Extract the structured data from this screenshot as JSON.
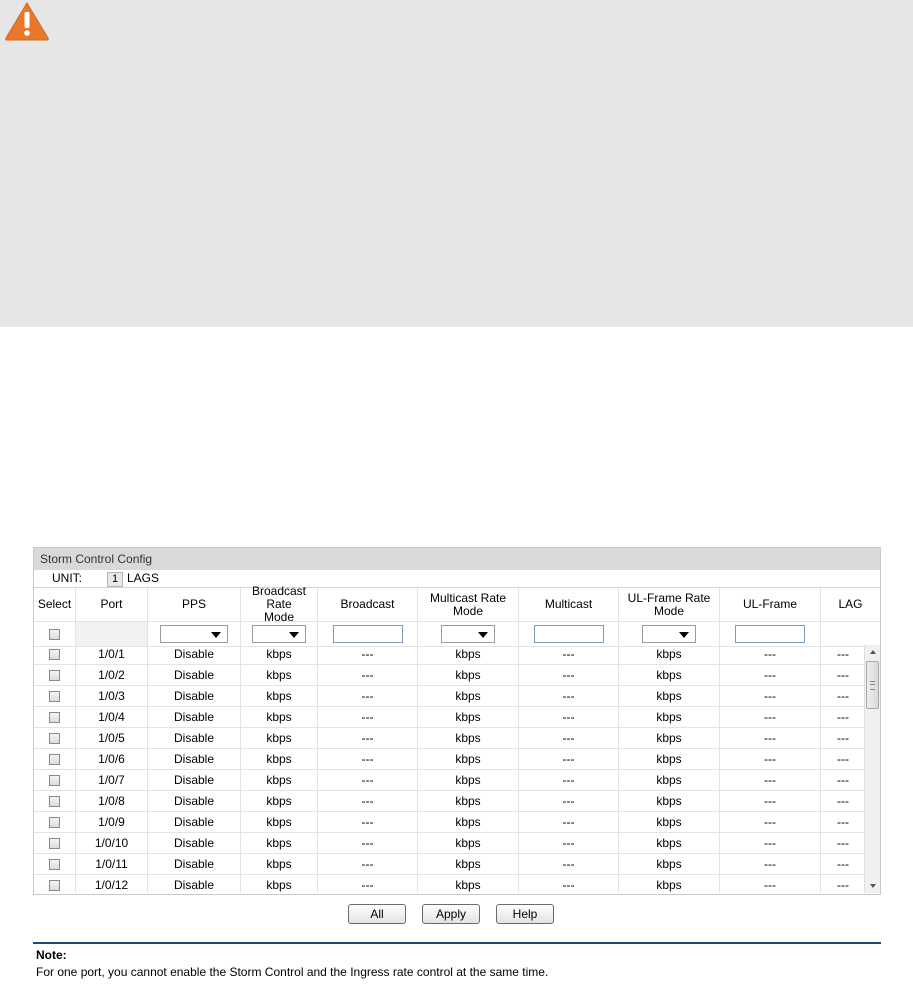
{
  "panel": {
    "title": "Storm Control Config",
    "unit_label": "UNIT:",
    "unit_value": "1",
    "lags_label": "LAGS"
  },
  "columns": {
    "select": "Select",
    "port": "Port",
    "pps": "PPS",
    "broadcast_rate_mode": "Broadcast Rate\nMode",
    "broadcast": "Broadcast",
    "multicast_rate_mode": "Multicast Rate\nMode",
    "multicast": "Multicast",
    "ulframe_rate_mode": "UL-Frame Rate\nMode",
    "ulframe": "UL-Frame",
    "lag": "LAG"
  },
  "rows": [
    {
      "port": "1/0/1",
      "pps": "Disable",
      "broadcast_rate_mode": "kbps",
      "broadcast": "---",
      "multicast_rate_mode": "kbps",
      "multicast": "---",
      "ulframe_rate_mode": "kbps",
      "ulframe": "---",
      "lag": "---"
    },
    {
      "port": "1/0/2",
      "pps": "Disable",
      "broadcast_rate_mode": "kbps",
      "broadcast": "---",
      "multicast_rate_mode": "kbps",
      "multicast": "---",
      "ulframe_rate_mode": "kbps",
      "ulframe": "---",
      "lag": "---"
    },
    {
      "port": "1/0/3",
      "pps": "Disable",
      "broadcast_rate_mode": "kbps",
      "broadcast": "---",
      "multicast_rate_mode": "kbps",
      "multicast": "---",
      "ulframe_rate_mode": "kbps",
      "ulframe": "---",
      "lag": "---"
    },
    {
      "port": "1/0/4",
      "pps": "Disable",
      "broadcast_rate_mode": "kbps",
      "broadcast": "---",
      "multicast_rate_mode": "kbps",
      "multicast": "---",
      "ulframe_rate_mode": "kbps",
      "ulframe": "---",
      "lag": "---"
    },
    {
      "port": "1/0/5",
      "pps": "Disable",
      "broadcast_rate_mode": "kbps",
      "broadcast": "---",
      "multicast_rate_mode": "kbps",
      "multicast": "---",
      "ulframe_rate_mode": "kbps",
      "ulframe": "---",
      "lag": "---"
    },
    {
      "port": "1/0/6",
      "pps": "Disable",
      "broadcast_rate_mode": "kbps",
      "broadcast": "---",
      "multicast_rate_mode": "kbps",
      "multicast": "---",
      "ulframe_rate_mode": "kbps",
      "ulframe": "---",
      "lag": "---"
    },
    {
      "port": "1/0/7",
      "pps": "Disable",
      "broadcast_rate_mode": "kbps",
      "broadcast": "---",
      "multicast_rate_mode": "kbps",
      "multicast": "---",
      "ulframe_rate_mode": "kbps",
      "ulframe": "---",
      "lag": "---"
    },
    {
      "port": "1/0/8",
      "pps": "Disable",
      "broadcast_rate_mode": "kbps",
      "broadcast": "---",
      "multicast_rate_mode": "kbps",
      "multicast": "---",
      "ulframe_rate_mode": "kbps",
      "ulframe": "---",
      "lag": "---"
    },
    {
      "port": "1/0/9",
      "pps": "Disable",
      "broadcast_rate_mode": "kbps",
      "broadcast": "---",
      "multicast_rate_mode": "kbps",
      "multicast": "---",
      "ulframe_rate_mode": "kbps",
      "ulframe": "---",
      "lag": "---"
    },
    {
      "port": "1/0/10",
      "pps": "Disable",
      "broadcast_rate_mode": "kbps",
      "broadcast": "---",
      "multicast_rate_mode": "kbps",
      "multicast": "---",
      "ulframe_rate_mode": "kbps",
      "ulframe": "---",
      "lag": "---"
    },
    {
      "port": "1/0/11",
      "pps": "Disable",
      "broadcast_rate_mode": "kbps",
      "broadcast": "---",
      "multicast_rate_mode": "kbps",
      "multicast": "---",
      "ulframe_rate_mode": "kbps",
      "ulframe": "---",
      "lag": "---"
    },
    {
      "port": "1/0/12",
      "pps": "Disable",
      "broadcast_rate_mode": "kbps",
      "broadcast": "---",
      "multicast_rate_mode": "kbps",
      "multicast": "---",
      "ulframe_rate_mode": "kbps",
      "ulframe": "---",
      "lag": "---"
    }
  ],
  "buttons": {
    "all": "All",
    "apply": "Apply",
    "help": "Help"
  },
  "note": {
    "title": "Note:",
    "text": "For one port, you cannot enable the Storm Control and the Ingress rate control at the same time."
  },
  "colors": {
    "warning_icon": "#e8792b",
    "warning_panel_bg": "#e6e6e6",
    "note_rule": "#1f4a6b"
  },
  "icons": {
    "warning": "warning-triangle-icon",
    "dropdown": "dropdown-arrow-icon",
    "scroll_up": "scroll-up-arrow-icon",
    "scroll_down": "scroll-down-arrow-icon"
  }
}
